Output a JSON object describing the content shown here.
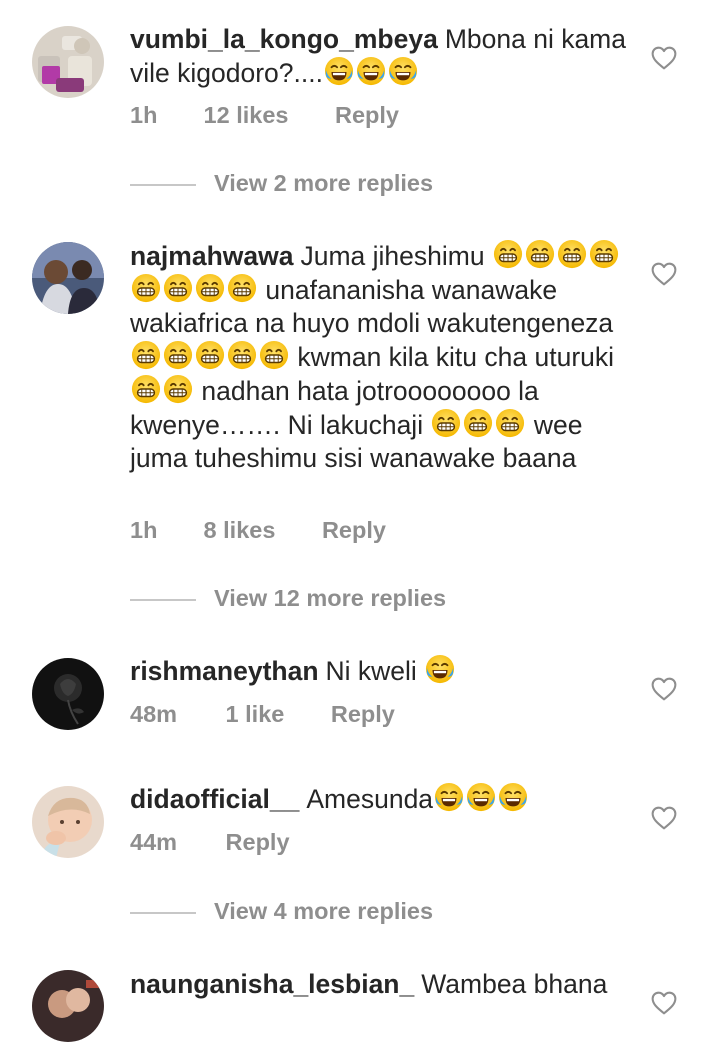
{
  "comments": [
    {
      "username": "vumbi_la_kongo_mbeya",
      "text_segments": [
        "Mbona ni kama vile kigodoro?....",
        "😂😂😂"
      ],
      "time": "1h",
      "likes": "12 likes",
      "reply": "Reply",
      "view_more": "View 2 more replies"
    },
    {
      "username": "najmahwawa",
      "text_parts": [
        "Juma jiheshimu ",
        "😁😁😁😁😁😁😁😁",
        " unafananisha wanawake wakiafrica na huyo mdoli wakutengeneza",
        "😁😁😁😁😁",
        " kwman kila kitu cha uturuki",
        "😁😁",
        " nadhan hata jotroooooooo la kwenye……. Ni lakuchaji ",
        "😁😁😁",
        " wee juma tuheshimu sisi wanawake baana"
      ],
      "time": "1h",
      "likes": "8 likes",
      "reply": "Reply",
      "view_more": "View 12 more replies"
    },
    {
      "username": "rishmaneythan",
      "text_parts": [
        "Ni kweli ",
        "😂"
      ],
      "time": "48m",
      "likes": "1 like",
      "reply": "Reply"
    },
    {
      "username": "didaofficial__",
      "text_parts": [
        "Amesunda",
        "😂😂😂"
      ],
      "time": "44m",
      "reply": "Reply",
      "view_more": "View 4 more replies"
    },
    {
      "username": "naunganisha_lesbian_",
      "text_parts": [
        "Wambea bhana"
      ]
    }
  ],
  "icons": {
    "like": "heart-outline-icon",
    "laugh": "face-with-tears-of-joy-emoji",
    "grin": "beaming-face-emoji"
  },
  "colors": {
    "text": "#262626",
    "secondary": "#8e8e8e",
    "rule": "#c7c7c7"
  }
}
